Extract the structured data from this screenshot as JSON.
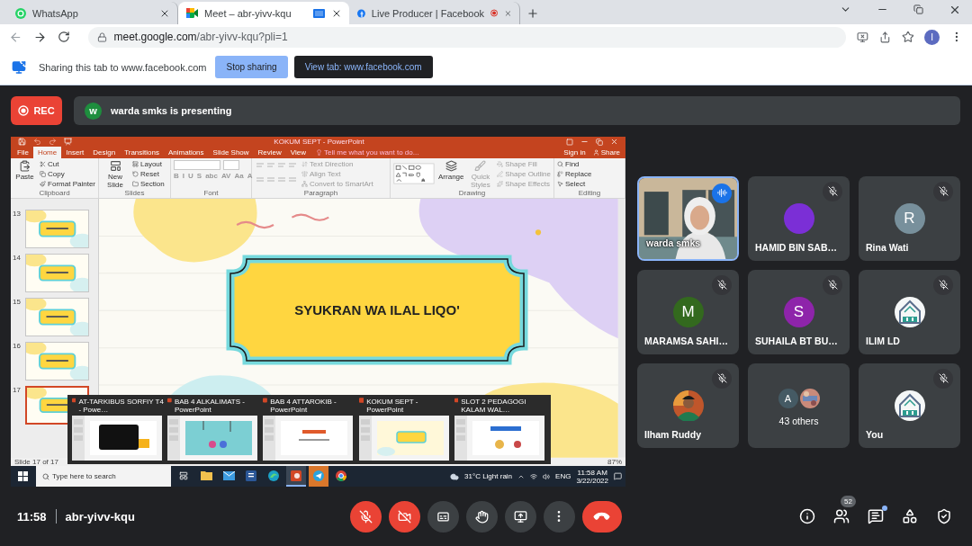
{
  "browser": {
    "tabs": [
      {
        "kind": "chat",
        "title": "WhatsApp",
        "selected": false,
        "sharing": false,
        "recording": false
      },
      {
        "kind": "meet",
        "title": "Meet – abr-yivv-kqu",
        "selected": true,
        "sharing": true,
        "recording": false
      },
      {
        "kind": "social",
        "title": "Live Producer | Facebook",
        "selected": false,
        "sharing": false,
        "recording": true
      }
    ],
    "url": {
      "host": "meet.google.com",
      "path": "/abr-yivv-kqu?pli=1"
    },
    "profile_initial": "I"
  },
  "share_bar": {
    "message": "Sharing this tab to www.facebook.com",
    "buttons": [
      {
        "kind": "primary",
        "label": "Stop sharing"
      },
      {
        "kind": "dark",
        "label": "View tab: www.facebook.com"
      }
    ]
  },
  "meet": {
    "recording_label": "REC",
    "presenter": {
      "initial": "w",
      "color": "#1e8e3e",
      "message": "warda smks is presenting"
    },
    "presentation": {
      "title": "KOKUM SEPT - PowerPoint",
      "ribbon_tabs": [
        {
          "label": "File",
          "selected": false
        },
        {
          "label": "Home",
          "selected": true
        },
        {
          "label": "Insert",
          "selected": false
        },
        {
          "label": "Design",
          "selected": false
        },
        {
          "label": "Transitions",
          "selected": false
        },
        {
          "label": "Animations",
          "selected": false
        },
        {
          "label": "Slide Show",
          "selected": false
        },
        {
          "label": "Review",
          "selected": false
        },
        {
          "label": "View",
          "selected": false
        }
      ],
      "tell_me": "Tell me what you want to do...",
      "sign_in": "Sign in",
      "share": "Share",
      "ribbon_groups": [
        {
          "kind": "clipboard",
          "label": "Clipboard",
          "large": [
            {
              "label": "Paste",
              "disabled": false
            }
          ],
          "items": [
            {
              "label": "Cut",
              "disabled": false
            },
            {
              "label": "Copy",
              "disabled": false
            },
            {
              "label": "Format Painter",
              "disabled": false
            }
          ]
        },
        {
          "kind": "slides",
          "label": "Slides",
          "large": [
            {
              "label": "New Slide",
              "disabled": false
            }
          ],
          "items": [
            {
              "label": "Layout",
              "disabled": false
            },
            {
              "label": "Reset",
              "disabled": false
            },
            {
              "label": "Section",
              "disabled": false
            }
          ]
        },
        {
          "kind": "font",
          "label": "Font",
          "items": [
            {
              "label": "B",
              "disabled": true
            },
            {
              "label": "I",
              "disabled": true
            },
            {
              "label": "U",
              "disabled": true
            },
            {
              "label": "S",
              "disabled": true
            },
            {
              "label": "abc",
              "disabled": true
            },
            {
              "label": "AV",
              "disabled": true
            },
            {
              "label": "Aa",
              "disabled": true
            },
            {
              "label": "A",
              "disabled": true
            }
          ]
        },
        {
          "kind": "paragraph",
          "label": "Paragraph",
          "items": [
            {
              "label": "Text Direction",
              "disabled": true
            },
            {
              "label": "Align Text",
              "disabled": true
            },
            {
              "label": "Convert to SmartArt",
              "disabled": true
            }
          ]
        },
        {
          "kind": "drawing",
          "label": "Drawing",
          "large": [
            {
              "label": "Arrange",
              "disabled": false
            },
            {
              "label": "Quick Styles",
              "disabled": true
            }
          ],
          "items": [
            {
              "label": "Shape Fill",
              "disabled": true
            },
            {
              "label": "Shape Outline",
              "disabled": true
            },
            {
              "label": "Shape Effects",
              "disabled": true
            }
          ]
        },
        {
          "kind": "editing",
          "label": "Editing",
          "items": [
            {
              "label": "Find",
              "disabled": false
            },
            {
              "label": "Replace",
              "disabled": false
            },
            {
              "label": "Select",
              "disabled": false
            }
          ]
        }
      ],
      "slides": [
        {
          "number": "13",
          "selected": false
        },
        {
          "number": "14",
          "selected": false
        },
        {
          "number": "15",
          "selected": false
        },
        {
          "number": "16",
          "selected": false
        },
        {
          "number": "17",
          "selected": true
        }
      ],
      "slide_text": "SYUKRAN WA ILAL LIQO'",
      "status": "Slide 17 of 17",
      "zoom": "87%",
      "previews": [
        {
          "title": "AT-TARKIBUS SORFIY T4 - Powe…"
        },
        {
          "title": "BAB 4 ALKALIMATS - PowerPoint"
        },
        {
          "title": "BAB 4 ATTAROKIB - PowerPoint"
        },
        {
          "title": "KOKUM SEPT - PowerPoint"
        },
        {
          "title": "SLOT 2 PEDAGOGI KALAM WAL…"
        }
      ],
      "taskbar": {
        "search_placeholder": "Type here to search",
        "apps": [
          {
            "kind": "folder",
            "active": false,
            "flashing": false
          },
          {
            "kind": "mail",
            "active": false,
            "flashing": false
          },
          {
            "kind": "word",
            "active": false,
            "flashing": false
          },
          {
            "kind": "edge",
            "active": false,
            "flashing": false
          },
          {
            "kind": "powerpoint",
            "active": true,
            "flashing": false
          },
          {
            "kind": "telegram",
            "active": false,
            "flashing": true
          },
          {
            "kind": "chrome",
            "active": false,
            "flashing": false
          }
        ],
        "weather": "31°C Light rain",
        "language": "ENG",
        "time": "11:58 AM",
        "date": "3/22/2022"
      }
    },
    "participants": [
      {
        "kind": "video",
        "name": "warda smks",
        "muted": false,
        "speaking": true
      },
      {
        "kind": "avatar",
        "name": "HAMID BIN SAB…",
        "color": "#7b2fd6",
        "muted": true,
        "speaking": false
      },
      {
        "kind": "initial",
        "name": "Rina Wati",
        "initial": "R",
        "color": "#78909c",
        "muted": true,
        "speaking": false
      },
      {
        "kind": "initial",
        "name": "MARAMSA SAHI…",
        "initial": "M",
        "color": "#33691e",
        "muted": true,
        "speaking": false
      },
      {
        "kind": "initial",
        "name": "SUHAILA BT BU…",
        "initial": "S",
        "color": "#8e24aa",
        "muted": true,
        "speaking": false
      },
      {
        "kind": "logo",
        "name": "ILIM LD",
        "muted": true,
        "speaking": false
      },
      {
        "name": "Ilham Ruddy",
        "muted": true,
        "speaking": false
      },
      {
        "kind": "others",
        "name": "43 others",
        "initial": "A",
        "color": "#455a64",
        "muted": false,
        "speaking": false
      },
      {
        "kind": "logo",
        "name": "You",
        "muted": true,
        "speaking": false
      }
    ],
    "time": "11:58",
    "meeting_code": "abr-yivv-kqu",
    "controls": [
      {
        "kind": "mic",
        "on": false
      },
      {
        "kind": "camera",
        "on": false
      },
      {
        "kind": "captions",
        "on": false
      },
      {
        "kind": "hand",
        "on": false
      },
      {
        "kind": "present",
        "on": false
      },
      {
        "kind": "more"
      },
      {
        "kind": "leave"
      }
    ],
    "side_buttons": [
      {
        "kind": "info"
      },
      {
        "kind": "people",
        "badge": "52"
      },
      {
        "kind": "chat",
        "unread": true
      },
      {
        "kind": "activities"
      },
      {
        "kind": "host"
      }
    ]
  }
}
